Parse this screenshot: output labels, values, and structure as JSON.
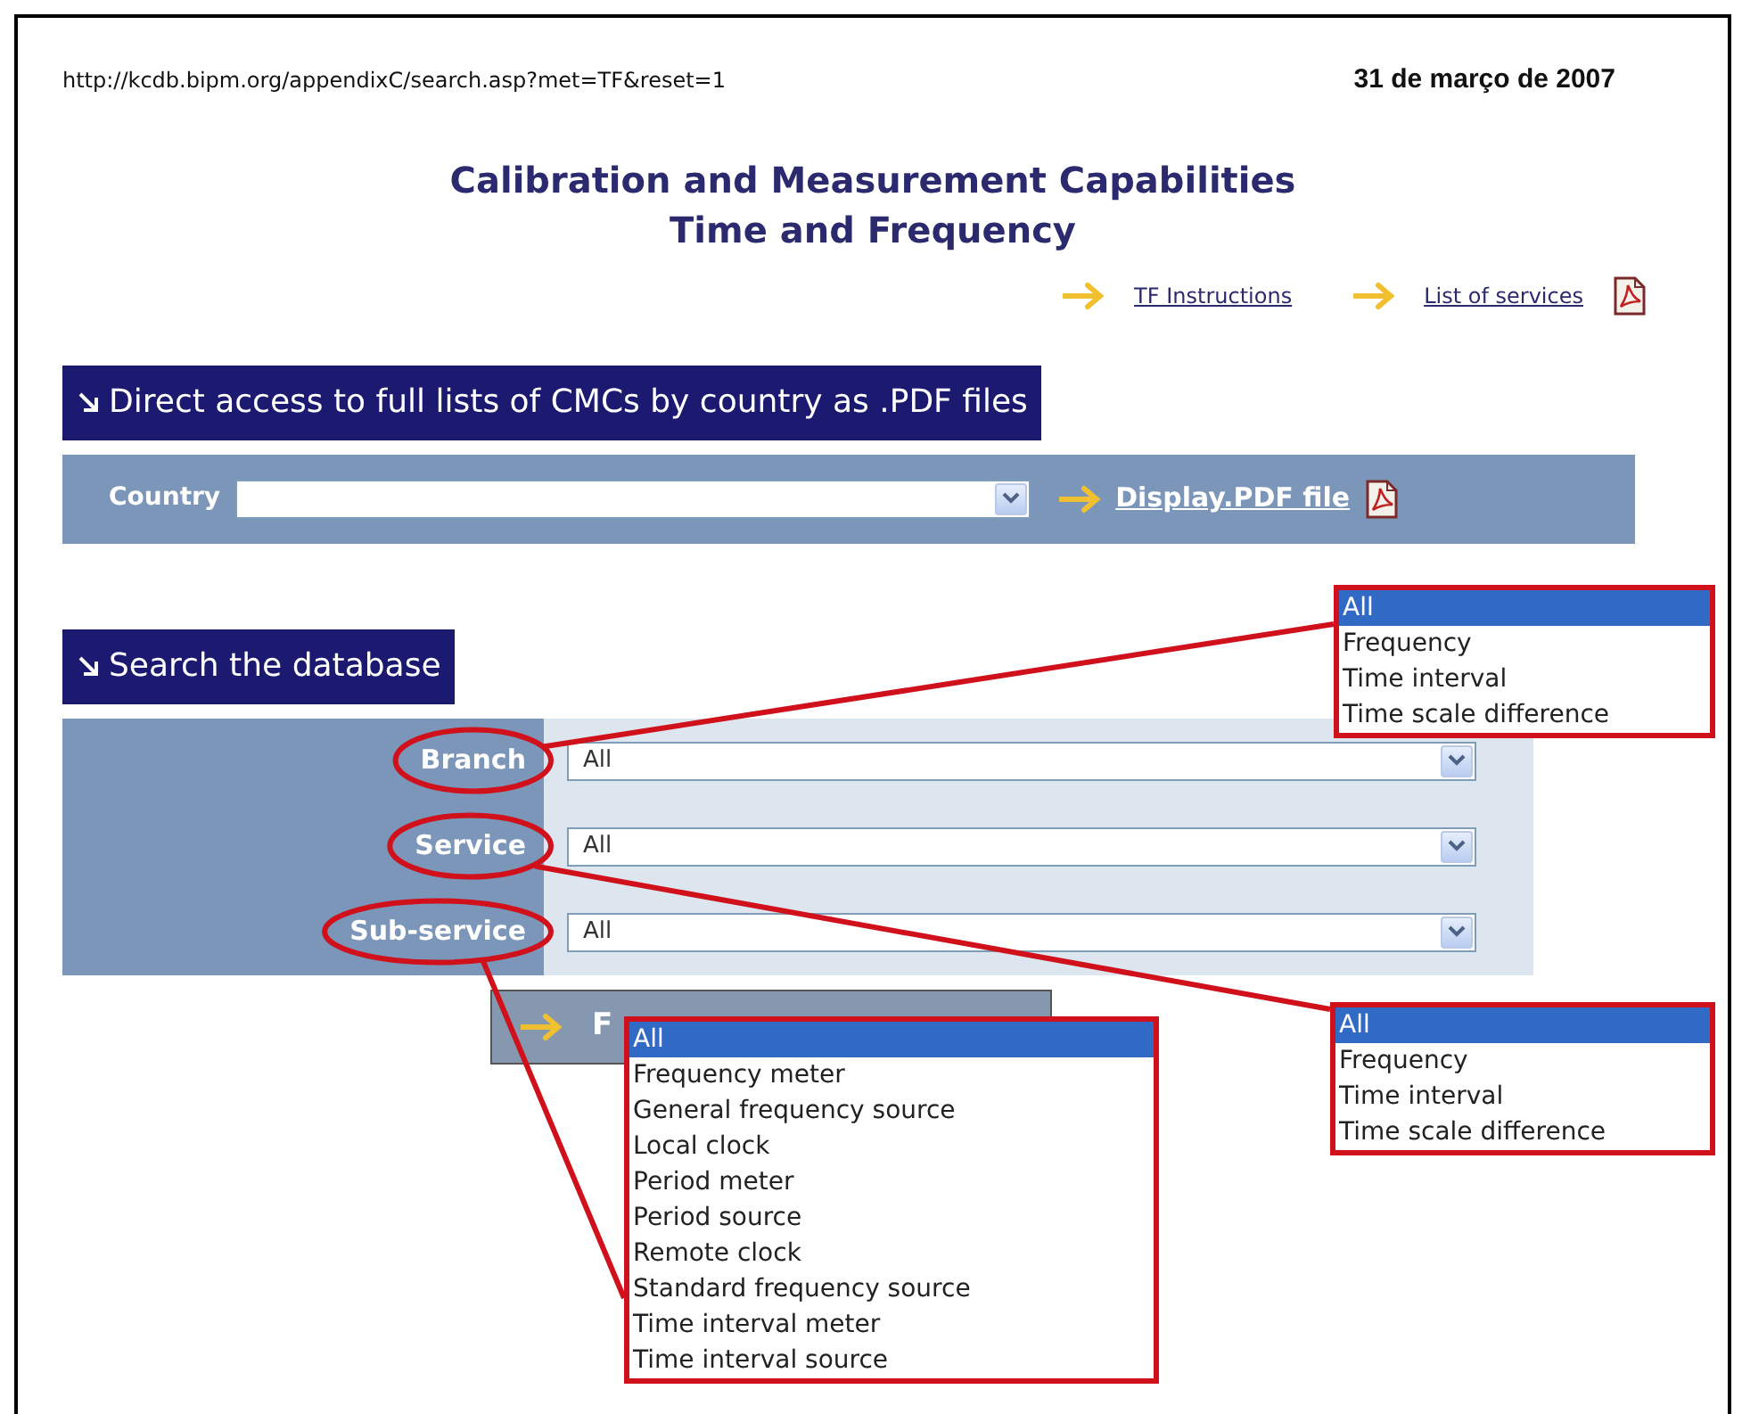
{
  "page": {
    "url": "http://kcdb.bipm.org/appendixC/search.asp?met=TF&reset=1",
    "date": "31 de março de 2007"
  },
  "title": [
    "Calibration and Measurement Capabilities",
    "Time and Frequency"
  ],
  "links": [
    {
      "label": "TF Instructions",
      "pdf": false
    },
    {
      "label": "List of services",
      "pdf": true
    }
  ],
  "country_section": {
    "heading": "Direct access to full lists of CMCs by country as .PDF files",
    "label": "Country",
    "button": "Display.PDF file"
  },
  "search_section": {
    "heading": "Search the database",
    "fields": [
      {
        "label": "Branch",
        "value": "All",
        "highlighted": true
      },
      {
        "label": "Service",
        "value": "All",
        "highlighted": true
      },
      {
        "label": "Sub-service",
        "value": "All",
        "highlighted": true
      }
    ],
    "button": "F"
  },
  "dropdowns": [
    {
      "options": [
        {
          "label": "All",
          "selected": true
        },
        {
          "label": "Frequency",
          "selected": false
        },
        {
          "label": "Time interval",
          "selected": false
        },
        {
          "label": "Time scale difference",
          "selected": false
        }
      ]
    },
    {
      "options": [
        {
          "label": "All",
          "selected": true
        },
        {
          "label": "Frequency",
          "selected": false
        },
        {
          "label": "Time interval",
          "selected": false
        },
        {
          "label": "Time scale difference",
          "selected": false
        }
      ]
    },
    {
      "options": [
        {
          "label": "All",
          "selected": true
        },
        {
          "label": "Frequency meter",
          "selected": false
        },
        {
          "label": "General frequency source",
          "selected": false
        },
        {
          "label": "Local clock",
          "selected": false
        },
        {
          "label": "Period meter",
          "selected": false
        },
        {
          "label": "Period source",
          "selected": false
        },
        {
          "label": "Remote clock",
          "selected": false
        },
        {
          "label": "Standard frequency source",
          "selected": false
        },
        {
          "label": "Time interval meter",
          "selected": false
        },
        {
          "label": "Time interval source",
          "selected": false
        }
      ]
    }
  ]
}
